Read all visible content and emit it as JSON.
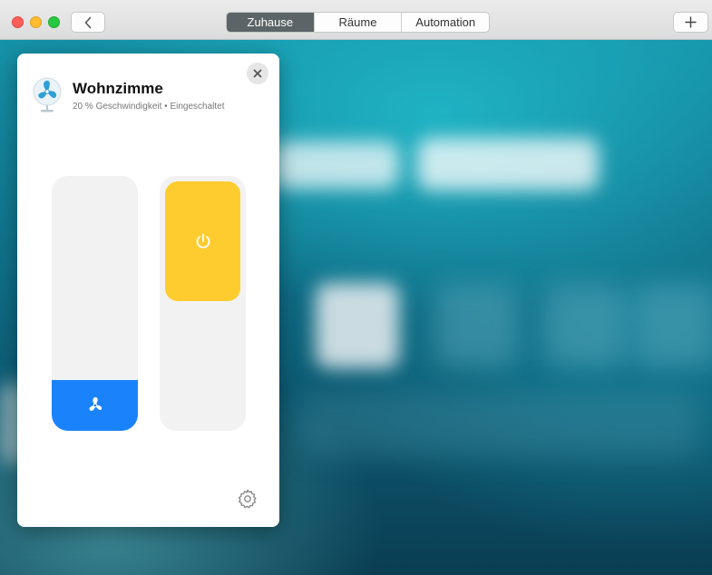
{
  "window": {
    "tabs": [
      {
        "label": "Zuhause",
        "active": true
      },
      {
        "label": "Räume",
        "active": false
      },
      {
        "label": "Automation",
        "active": false
      }
    ],
    "back_icon": "chevron-left-icon",
    "add_label": "+"
  },
  "accessory": {
    "name": "Wohnzimme",
    "status": "20 % Geschwindigkeit • Eingeschaltet",
    "icon": "fan-icon",
    "speed_percent": 20,
    "power_on": true,
    "accent_speed": "#1a83fb",
    "accent_power": "#ffcc2f",
    "close_icon": "close-icon",
    "settings_icon": "gear-icon"
  }
}
